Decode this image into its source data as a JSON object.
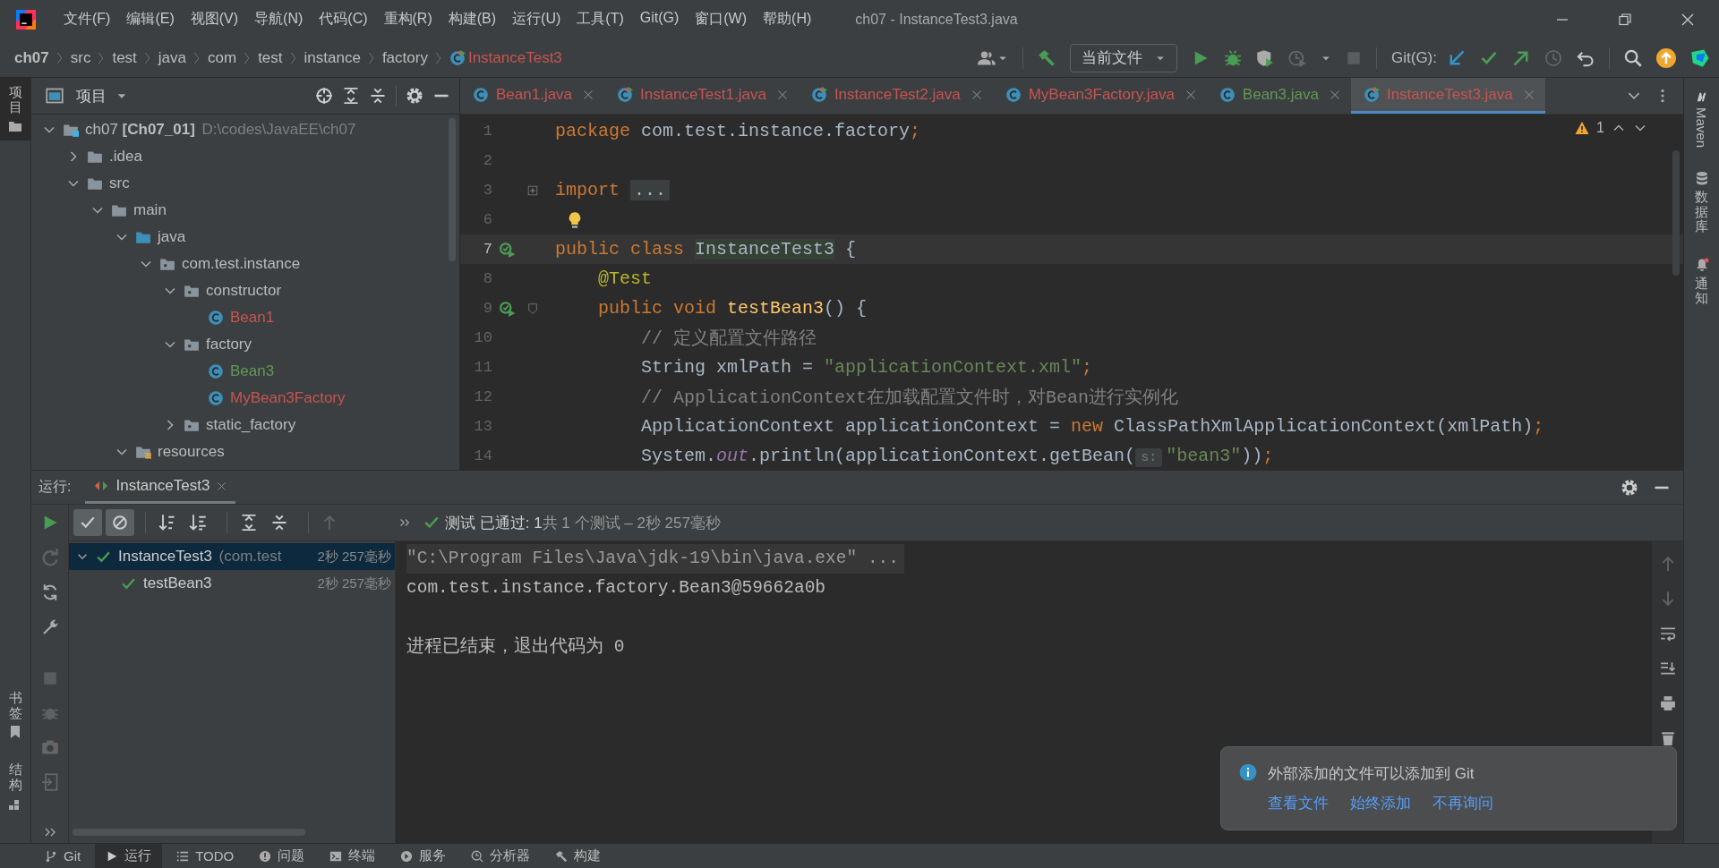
{
  "window": {
    "title": "ch07 - InstanceTest3.java"
  },
  "menu": [
    "文件(F)",
    "编辑(E)",
    "视图(V)",
    "导航(N)",
    "代码(C)",
    "重构(R)",
    "构建(B)",
    "运行(U)",
    "工具(T)",
    "Git(G)",
    "窗口(W)",
    "帮助(H)"
  ],
  "breadcrumbs": [
    {
      "label": "ch07",
      "kind": "module"
    },
    {
      "label": "src",
      "kind": "dir"
    },
    {
      "label": "test",
      "kind": "dir"
    },
    {
      "label": "java",
      "kind": "dir"
    },
    {
      "label": "com",
      "kind": "dir"
    },
    {
      "label": "test",
      "kind": "dir"
    },
    {
      "label": "instance",
      "kind": "dir"
    },
    {
      "label": "factory",
      "kind": "dir"
    },
    {
      "label": "InstanceTest3",
      "kind": "test",
      "color": "#c75450"
    }
  ],
  "toolbar": {
    "run_config": "当前文件",
    "git_label": "Git(G):"
  },
  "left_stripe": [
    {
      "label": "项目",
      "kind": "project",
      "selected": true
    }
  ],
  "left_stripe_bottom": [
    {
      "label": "书签",
      "kind": "bookmarks",
      "selected": false
    },
    {
      "label": "结构",
      "kind": "structure",
      "selected": false
    }
  ],
  "right_stripe": [
    {
      "label": "Maven",
      "kind": "maven"
    },
    {
      "label": "数据库",
      "kind": "database"
    },
    {
      "label": "通知",
      "kind": "notifications"
    }
  ],
  "project_panel": {
    "title": "项目",
    "tree": [
      {
        "kind": "module",
        "name": "ch07",
        "module": "[Ch07_01]",
        "path": "D:\\codes\\JavaEE\\ch07",
        "expanded": true,
        "children": [
          {
            "kind": "folder",
            "name": ".idea",
            "expanded": false
          },
          {
            "kind": "folder",
            "name": "src",
            "expanded": true,
            "children": [
              {
                "kind": "folder",
                "name": "main",
                "expanded": true,
                "children": [
                  {
                    "kind": "source_root",
                    "name": "java",
                    "expanded": true,
                    "children": [
                      {
                        "kind": "package",
                        "name": "com.test.instance",
                        "expanded": true,
                        "children": [
                          {
                            "kind": "package",
                            "name": "constructor",
                            "expanded": true,
                            "children": [
                              {
                                "kind": "class",
                                "name": "Bean1",
                                "color": "#c75450"
                              }
                            ]
                          },
                          {
                            "kind": "package",
                            "name": "factory",
                            "expanded": true,
                            "children": [
                              {
                                "kind": "class",
                                "name": "Bean3",
                                "color": "#629755"
                              },
                              {
                                "kind": "class",
                                "name": "MyBean3Factory",
                                "color": "#c75450"
                              }
                            ]
                          },
                          {
                            "kind": "package",
                            "name": "static_factory",
                            "expanded": false
                          }
                        ]
                      }
                    ]
                  },
                  {
                    "kind": "resources",
                    "name": "resources",
                    "expanded": true
                  }
                ]
              }
            ]
          }
        ]
      }
    ]
  },
  "editor_tabs": [
    {
      "label": "Bean1.java",
      "kind": "class",
      "color": "#c75450",
      "selected": false
    },
    {
      "label": "InstanceTest1.java",
      "kind": "test",
      "color": "#c75450",
      "selected": false
    },
    {
      "label": "InstanceTest2.java",
      "kind": "test",
      "color": "#c75450",
      "selected": false
    },
    {
      "label": "MyBean3Factory.java",
      "kind": "class",
      "color": "#c75450",
      "selected": false
    },
    {
      "label": "Bean3.java",
      "kind": "class",
      "color": "#629755",
      "selected": false
    },
    {
      "label": "InstanceTest3.java",
      "kind": "test",
      "color": "#c75450",
      "selected": true
    }
  ],
  "editor": {
    "warnings": "1",
    "lines": [
      {
        "num": "1",
        "current": false,
        "run": false,
        "bulb": false,
        "tokens": [
          {
            "kind": "keyword",
            "text": "package"
          },
          {
            "kind": "plain",
            "text": " com.test.instance.factory"
          },
          {
            "kind": "keyword",
            "text": ";"
          }
        ]
      },
      {
        "num": "2",
        "current": false,
        "run": false,
        "bulb": false
      },
      {
        "num": "3",
        "current": false,
        "run": false,
        "bulb": false,
        "fold_marker": {
          "kind": "collapsed"
        },
        "tokens": [
          {
            "kind": "keyword",
            "text": "import "
          },
          {
            "kind": "folded",
            "text": "..."
          }
        ]
      },
      {
        "num": "6",
        "current": false,
        "run": false,
        "bulb": true
      },
      {
        "num": "7",
        "current": true,
        "run": true,
        "bulb": false,
        "tokens": [
          {
            "kind": "keyword",
            "text": "public class "
          },
          {
            "kind": "usage",
            "text": "InstanceTest3"
          },
          {
            "kind": "plain",
            "text": " {"
          }
        ]
      },
      {
        "num": "8",
        "current": false,
        "run": false,
        "bulb": false,
        "tokens": [
          {
            "kind": "annotation",
            "text": "    @Test"
          }
        ]
      },
      {
        "num": "9",
        "current": false,
        "run": true,
        "bulb": false,
        "fold_marker": {
          "kind": "expanded"
        },
        "tokens": [
          {
            "kind": "keyword",
            "text": "    public void "
          },
          {
            "kind": "method",
            "text": "testBean3"
          },
          {
            "kind": "plain",
            "text": "() {"
          }
        ]
      },
      {
        "num": "10",
        "current": false,
        "run": false,
        "bulb": false,
        "tokens": [
          {
            "kind": "comment",
            "text": "        // 定义配置文件路径"
          }
        ]
      },
      {
        "num": "11",
        "current": false,
        "run": false,
        "bulb": false,
        "tokens": [
          {
            "kind": "plain",
            "text": "        String xmlPath = "
          },
          {
            "kind": "string",
            "text": "\"applicationContext.xml\""
          },
          {
            "kind": "keyword",
            "text": ";"
          }
        ]
      },
      {
        "num": "12",
        "current": false,
        "run": false,
        "bulb": false,
        "tokens": [
          {
            "kind": "comment",
            "text": "        // ApplicationContext在加载配置文件时，对Bean进行实例化"
          }
        ]
      },
      {
        "num": "13",
        "current": false,
        "run": false,
        "bulb": false,
        "tokens": [
          {
            "kind": "plain",
            "text": "        ApplicationContext applicationContext = "
          },
          {
            "kind": "keyword",
            "text": "new"
          },
          {
            "kind": "plain",
            "text": " ClassPathXmlApplicationContext(xmlPath)"
          },
          {
            "kind": "keyword",
            "text": ";"
          }
        ]
      },
      {
        "num": "14",
        "current": false,
        "run": false,
        "bulb": false,
        "tokens": [
          {
            "kind": "plain",
            "text": "        System."
          },
          {
            "kind": "static",
            "text": "out"
          },
          {
            "kind": "plain",
            "text": ".println(applicationContext.getBean("
          },
          {
            "kind": "hint",
            "text": "s:"
          },
          {
            "kind": "string",
            "text": "\"bean3\""
          },
          {
            "kind": "plain",
            "text": "))"
          },
          {
            "kind": "keyword",
            "text": ";"
          }
        ]
      }
    ]
  },
  "run_panel": {
    "label": "运行:",
    "tab": {
      "label": "InstanceTest3",
      "selected": true
    },
    "show_passed": true,
    "show_ignored": true,
    "status": {
      "passed": "测试 已通过: 1",
      "summary": "共 1 个测试 – 2秒 257毫秒"
    },
    "tests": [
      {
        "name": "InstanceTest3",
        "detail": "(com.test",
        "time": "2秒 257毫秒",
        "passed": true,
        "selected": true,
        "expanded": true,
        "children": [
          {
            "name": "testBean3",
            "time": "2秒 257毫秒",
            "passed": true,
            "selected": false
          }
        ]
      }
    ],
    "console": [
      {
        "kind": "command",
        "text": "\"C:\\Program Files\\Java\\jdk-19\\bin\\java.exe\" ..."
      },
      {
        "kind": "output",
        "text": "com.test.instance.factory.Bean3@59662a0b"
      },
      {
        "kind": "exit",
        "text": "进程已结束，退出代码为 0"
      }
    ]
  },
  "notification": {
    "message": "外部添加的文件可以添加到 Git",
    "actions": [
      "查看文件",
      "始终添加",
      "不再询问"
    ]
  },
  "bottom_bar": [
    {
      "label": "Git",
      "kind": "git",
      "selected": false
    },
    {
      "label": "运行",
      "kind": "run",
      "selected": true
    },
    {
      "label": "TODO",
      "kind": "todo",
      "selected": false
    },
    {
      "label": "问题",
      "kind": "problems",
      "selected": false
    },
    {
      "label": "终端",
      "kind": "terminal",
      "selected": false
    },
    {
      "label": "服务",
      "kind": "services",
      "selected": false
    },
    {
      "label": "分析器",
      "kind": "profiler",
      "selected": false
    },
    {
      "label": "构建",
      "kind": "build",
      "selected": false
    }
  ]
}
